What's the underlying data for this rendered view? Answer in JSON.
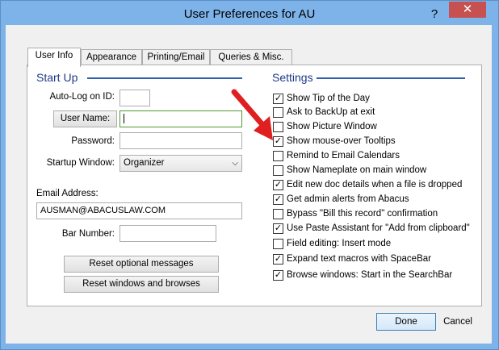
{
  "window": {
    "title": "User Preferences for AU",
    "help_label": "?",
    "close_label": "✕"
  },
  "tabs": [
    {
      "label": "User Info",
      "active": true
    },
    {
      "label": "Appearance"
    },
    {
      "label": "Printing/Email"
    },
    {
      "label": "Queries & Misc."
    }
  ],
  "start_up": {
    "title": "Start Up",
    "auto_log_label": "Auto-Log on ID:",
    "auto_log_value": "",
    "user_name_button": "User Name:",
    "user_name_value": "",
    "password_label": "Password:",
    "password_value": "",
    "startup_window_label": "Startup Window:",
    "startup_window_value": "Organizer",
    "email_label": "Email Address:",
    "email_value": "AUSMAN@ABACUSLAW.COM",
    "bar_number_label": "Bar Number:",
    "bar_number_value": "",
    "reset_messages_button": "Reset optional messages",
    "reset_windows_button": "Reset windows and browses"
  },
  "settings": {
    "title": "Settings",
    "items": [
      {
        "label": "Show Tip of the Day",
        "checked": true
      },
      {
        "label": "Ask to BackUp at exit",
        "checked": false
      },
      {
        "label": "Show Picture Window",
        "checked": false
      },
      {
        "label": "Show mouse-over Tooltips",
        "checked": true
      },
      {
        "label": "Remind to Email Calendars",
        "checked": false
      },
      {
        "label": "Show Nameplate on main window",
        "checked": false
      },
      {
        "label": "Edit new doc details when a file is dropped",
        "checked": true
      },
      {
        "label": "Get admin alerts from Abacus",
        "checked": true
      },
      {
        "label": "Bypass \"Bill this record\" confirmation",
        "checked": false
      },
      {
        "label": "Use Paste Assistant for \"Add from clipboard\"",
        "checked": true
      },
      {
        "label": "Field editing: Insert mode",
        "checked": false
      },
      {
        "label": "Expand text macros with SpaceBar",
        "checked": true
      },
      {
        "label": "Browse windows: Start in the SearchBar",
        "checked": true
      }
    ]
  },
  "footer": {
    "done_label": "Done",
    "cancel_label": "Cancel"
  },
  "colors": {
    "titlebar": "#7eb3ea",
    "close": "#c75050",
    "annotation_arrow": "#e02020",
    "section_title": "#1e3a8a"
  },
  "icons": {
    "close": "close-icon",
    "help": "help-icon",
    "dropdown": "chevron-down-icon",
    "check": "checkmark-icon",
    "annotation": "red-arrow"
  }
}
